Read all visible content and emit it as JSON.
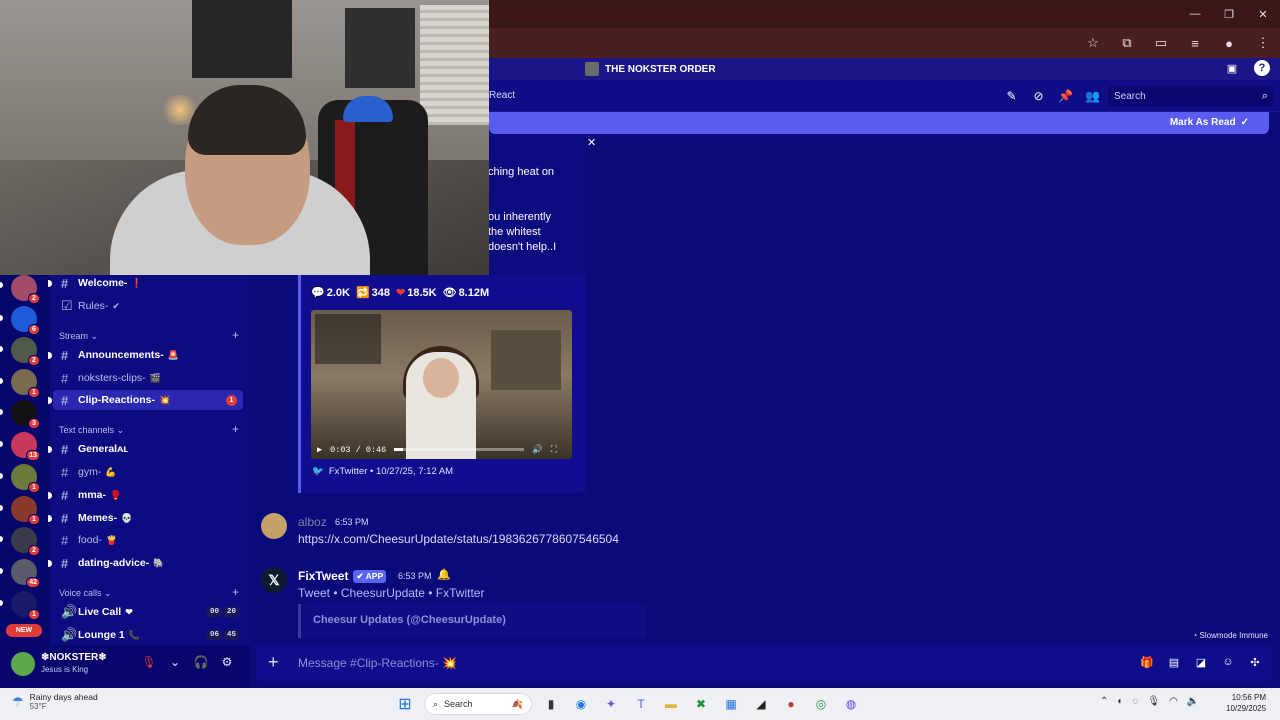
{
  "server": {
    "name": "THE NOKSTER ORDER"
  },
  "header": {
    "crumb": "React",
    "search_placeholder": "Search",
    "mark_as_read": "Mark As Read"
  },
  "rail_badges": [
    "2",
    "6",
    "2",
    "1",
    "3",
    "13",
    "1",
    "1",
    "2",
    "42",
    "1"
  ],
  "rail_new": "NEW",
  "sidebar": {
    "channels_top": [
      {
        "label": "Welcome-",
        "emoji": "❗"
      },
      {
        "label": "Rules-",
        "emoji": "✔"
      }
    ],
    "categories": {
      "stream": "Stream",
      "text": "Text channels",
      "voice": "Voice calls"
    },
    "stream_channels": [
      {
        "label": "Announcements-",
        "emoji": "🚨"
      },
      {
        "label": "noksters-clips-",
        "emoji": "🎬"
      },
      {
        "label": "Clip-Reactions-",
        "emoji": "💥",
        "count": "1"
      }
    ],
    "text_channels": [
      {
        "label": "Generalᴀʟ"
      },
      {
        "label": "gym-",
        "emoji": "💪"
      },
      {
        "label": "mma-",
        "emoji": "🥊"
      },
      {
        "label": "Memes-",
        "emoji": "💀"
      },
      {
        "label": "food-",
        "emoji": "🍟"
      },
      {
        "label": "dating-advice-",
        "emoji": "🐘"
      }
    ],
    "voice_channels": [
      {
        "label": "Live Call",
        "emoji": "❤",
        "t1": "00",
        "t2": "20"
      },
      {
        "label": "Lounge 1",
        "emoji": "📞",
        "t1": "06",
        "t2": "45"
      }
    ]
  },
  "user": {
    "name": "❄NOKSTER❄",
    "status": "Jesus is King"
  },
  "fragments": {
    "l1": "ching heat on",
    "l2": "ou inherently",
    "l3": "the whitest",
    "l4": "doesn't help..I"
  },
  "embed": {
    "comments": "2.0K",
    "retweets": "348",
    "likes": "18.5K",
    "views": "8.12M",
    "video_time": "0:03 / 0:46",
    "video_progress": 0.07,
    "footer": "FxTwitter • 10/27/25, 7:12 AM"
  },
  "messages": [
    {
      "author": "alboz",
      "time": "6:53 PM",
      "text": "https://x.com/CheesurUpdate/status/1983626778607546504"
    },
    {
      "author": "FixTweet",
      "tag": "✔ APP",
      "time": "6:53 PM",
      "text": "Tweet • CheesurUpdate • FxTwitter",
      "quote": "Cheesur Updates (@CheesurUpdate)"
    }
  ],
  "slowmode": "Slowmode Immune",
  "composer": {
    "placeholder": "Message #Clip-Reactions- 💥"
  },
  "taskbar": {
    "weather_title": "Rainy days ahead",
    "weather_temp": "53°F",
    "search": "Search",
    "time": "10:56 PM",
    "date": "10/29/2025"
  }
}
